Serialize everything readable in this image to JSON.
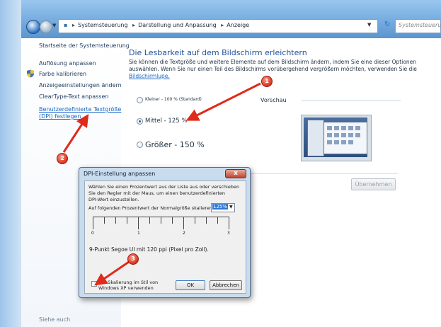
{
  "address": {
    "crumbs": [
      "Systemsteuerung",
      "Darstellung und Anpassung",
      "Anzeige"
    ],
    "search_placeholder": "Systemsteuerung"
  },
  "sidebar": {
    "home": "Startseite der Systemsteuerung",
    "items": [
      {
        "label": "Auflösung anpassen"
      },
      {
        "label": "Farbe kalibrieren",
        "icon": "shield-icon"
      },
      {
        "label": "Anzeigeeinstellungen ändern"
      },
      {
        "label": "ClearType-Text anpassen"
      },
      {
        "label_line1": "Benutzerdefinierte Textgröße",
        "label_line2": "(DPI) festlegen"
      }
    ],
    "see_also": "Siehe auch"
  },
  "main": {
    "title": "Die Lesbarkeit auf dem Bildschirm erleichtern",
    "desc_line1": "Sie können die Textgröße und weitere Elemente auf dem Bildschirm ändern, indem Sie eine dieser Optionen",
    "desc_line2": "auswählen. Wenn Sie nur einen Teil des Bildschirms vorübergehend vergrößern möchten, verwenden Sie die",
    "desc_link": "Bildschirmlupe.",
    "options": [
      {
        "label": "Kleiner - 100 % (Standard)",
        "checked": false
      },
      {
        "label": "Mittel - 125 %",
        "checked": true
      },
      {
        "label": "Größer - 150 %",
        "checked": false
      }
    ],
    "preview_label": "Vorschau",
    "apply_label": "Übernehmen"
  },
  "dialog": {
    "title": "DPI-Einstellung anpassen",
    "close": "x",
    "text_line1": "Wählen Sie einen Prozentwert aus der Liste aus oder verschieben",
    "text_line2": "Sie den Regler mit der Maus, um einen benutzerdefinierten",
    "text_line3": "DPI-Wert einzustellen.",
    "scale_label": "Auf folgenden Prozentwert der Normalgröße skalieren:",
    "scale_value": "125%",
    "ruler_numbers": [
      "0",
      "1",
      "2",
      "3"
    ],
    "ppi_text": "9-Punkt Segoe UI mit 120 ppi (Pixel pro Zoll).",
    "xp_line1": "DPI-Skalierung im Stil von",
    "xp_line2": "Windows XP verwenden",
    "xp_checked": false,
    "ok_label": "OK",
    "cancel_label": "Abbrechen"
  },
  "annotations": {
    "badges": [
      "1",
      "2",
      "3"
    ],
    "color": "#e02a1a"
  },
  "colors": {
    "link": "#1a69c8",
    "heading": "#1e4f9a",
    "accent": "#3178d0"
  }
}
